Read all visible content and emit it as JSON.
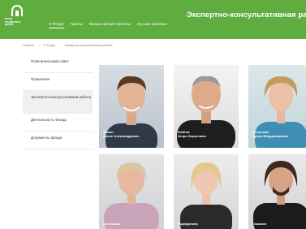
{
  "logo": {
    "lines": [
      "ФОНД",
      "ПОДДЕРЖКИ",
      "ДЕТЕЙ"
    ]
  },
  "nav": {
    "items": [
      "О Фонде",
      "Гранты",
      "Всероссийские проекты",
      "Лучшие практики"
    ]
  },
  "header": {
    "title": "Экспертно-консультативная работа"
  },
  "breadcrumb": [
    "Главная",
    "→",
    "О Фонде",
    "→",
    "Экспертно-консультативная работа"
  ],
  "sidebar": {
    "items": [
      "Попечительский совет",
      "Правление",
      "Экспертно-консультативная работа",
      "Деятельность Фонда",
      "Документы фонда"
    ]
  },
  "cards": [
    {
      "surname": "Фокин",
      "name": "Денис Александрович"
    },
    {
      "surname": "Бойтов",
      "name": "Игорь Борисович"
    },
    {
      "surname": "Вольнова",
      "name": "Ирина Владимировна"
    },
    {
      "surname": "Волочкова",
      "name": ""
    },
    {
      "surname": "Гарифулина",
      "name": ""
    },
    {
      "surname": "Гамалов",
      "name": ""
    }
  ],
  "colors": {
    "header_bg": "#5fad3f",
    "active_side": "#f0f0f0"
  }
}
